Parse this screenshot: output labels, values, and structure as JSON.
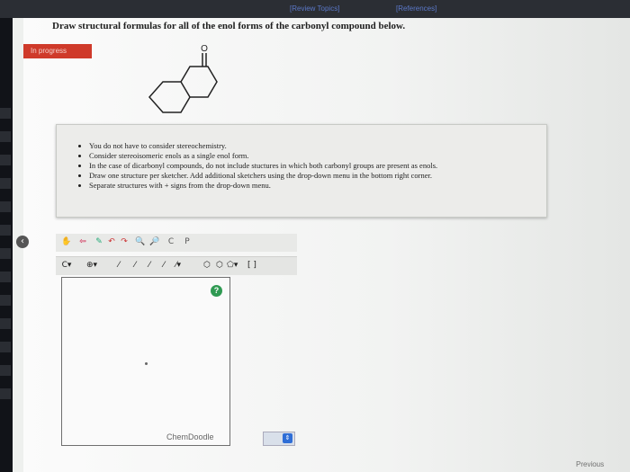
{
  "topbar": {
    "review_link": "[Review Topics]",
    "references_link": "[References]"
  },
  "question": "Draw structural formulas for all of the enol forms of the carbonyl compound below.",
  "status_badge": "In progress",
  "molecule": {
    "heteroatom": "O"
  },
  "instructions": [
    "You do not have to consider stereochemistry.",
    "Consider stereoisomeric enols as a single enol form.",
    "In the case of dicarbonyl compounds, do not include stuctures in which both carbonyl groups are present as enols.",
    "Draw one structure per sketcher. Add additional sketchers using the drop-down menu in the bottom right corner.",
    "Separate structures with + signs from the drop-down menu."
  ],
  "sketcher": {
    "watermark": "ChemDoodle",
    "help_icon_label": "?"
  },
  "footer": {
    "previous_link": "Previous"
  }
}
